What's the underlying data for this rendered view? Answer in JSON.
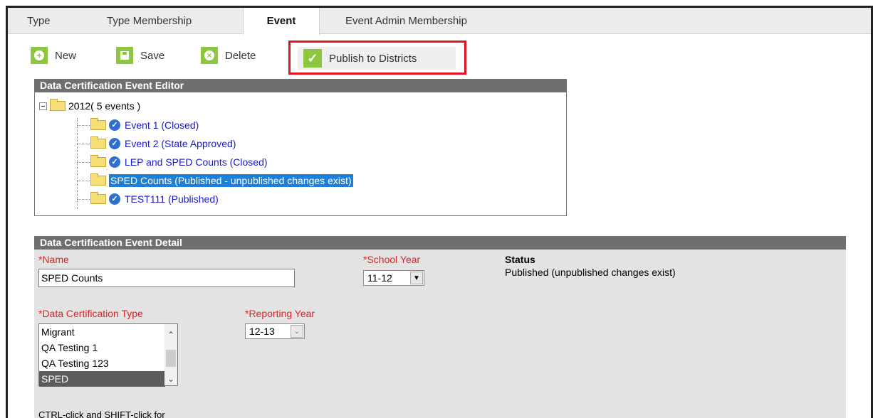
{
  "tabs": [
    {
      "label": "Type"
    },
    {
      "label": "Type Membership"
    },
    {
      "label": "Event"
    },
    {
      "label": "Event Admin Membership"
    }
  ],
  "toolbar": {
    "new_label": "New",
    "save_label": "Save",
    "delete_label": "Delete",
    "publish_label": "Publish to Districts"
  },
  "editor": {
    "header": "Data Certification Event Editor",
    "folder_label": "2012( 5 events )",
    "items": [
      {
        "label": "Event 1 (Closed)"
      },
      {
        "label": "Event 2 (State Approved)"
      },
      {
        "label": "LEP and SPED Counts (Closed)"
      },
      {
        "label": "SPED Counts (Published - unpublished changes exist)"
      },
      {
        "label": "TEST111 (Published)"
      }
    ]
  },
  "detail": {
    "header": "Data Certification Event Detail",
    "name_label": "*Name",
    "name_value": "SPED Counts",
    "school_year_label": "*School Year",
    "school_year_value": "11-12",
    "status_label": "Status",
    "status_value": "Published (unpublished changes exist)",
    "type_label": "*Data Certification Type",
    "type_options": [
      "Migrant",
      "QA Testing 1",
      "QA Testing 123",
      "SPED"
    ],
    "reporting_year_label": "*Reporting Year",
    "reporting_year_value": "12-13",
    "hint": "CTRL-click and SHIFT-click for"
  },
  "colors": {
    "accent_green": "#8dc63f",
    "highlight_red": "#e0141e",
    "panel_header": "#6f6f6f",
    "selection_blue": "#1e7fd6",
    "required_red": "#e02020"
  }
}
